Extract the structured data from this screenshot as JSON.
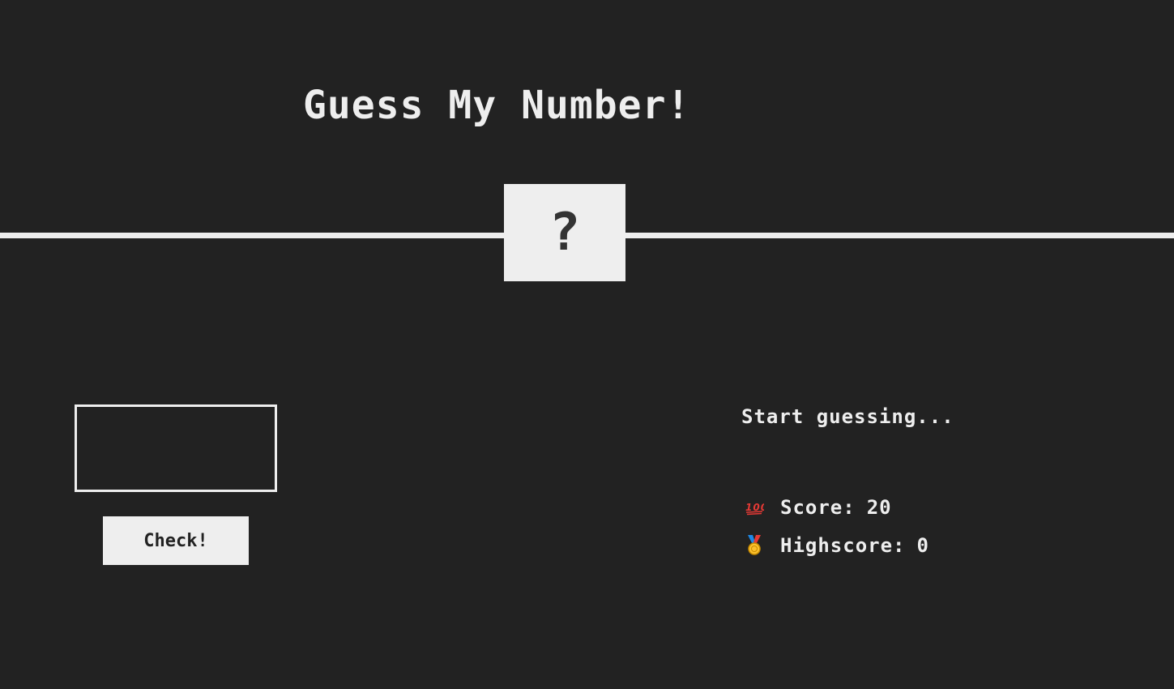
{
  "header": {
    "title": "Guess My Number!"
  },
  "secret": {
    "display": "?"
  },
  "guess": {
    "value": "",
    "placeholder": ""
  },
  "actions": {
    "check_label": "Check!"
  },
  "status": {
    "message": "Start guessing..."
  },
  "stats": {
    "score_icon": "hundred-points-icon",
    "score_label": "Score:",
    "score_value": "20",
    "highscore_icon": "medal-icon",
    "highscore_label": "Highscore:",
    "highscore_value": "0"
  },
  "colors": {
    "background": "#222222",
    "foreground": "#eeeeee",
    "secret_text": "#333333"
  }
}
